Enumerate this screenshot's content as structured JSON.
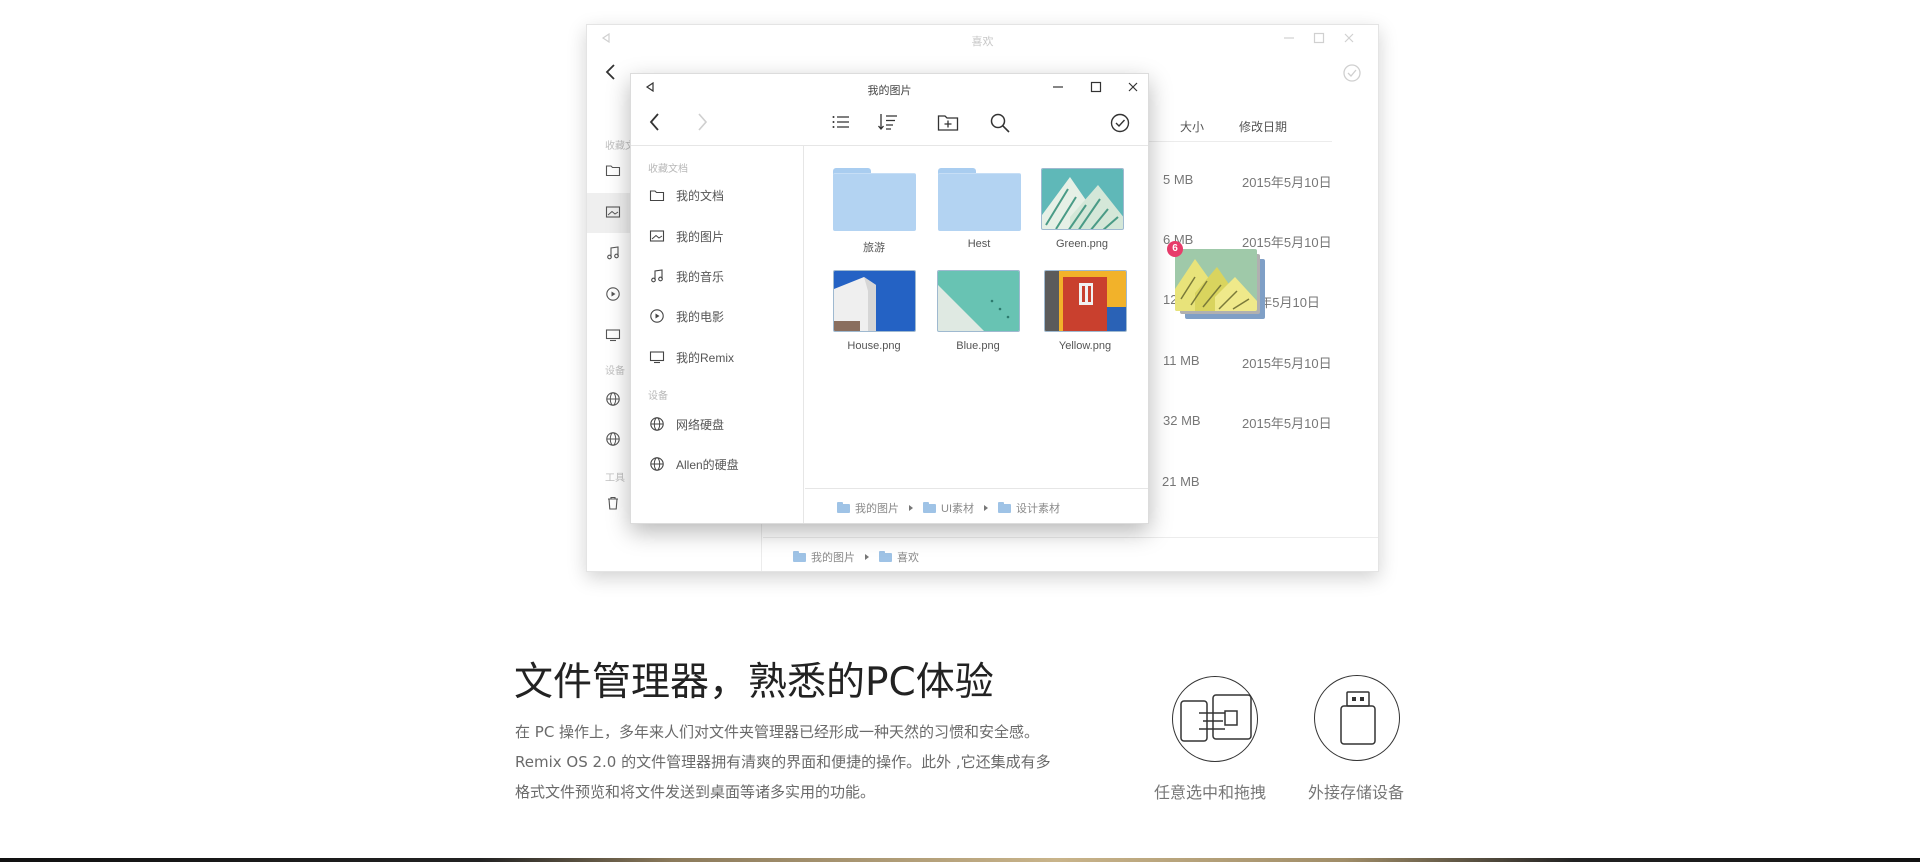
{
  "background_window": {
    "title": "喜欢",
    "columns": {
      "size": "大小",
      "date": "修改日期"
    },
    "sidebar_captions": [
      "收藏文",
      "设备",
      "工具"
    ],
    "rows": [
      {
        "size": "5 MB",
        "date": "2015年5月10日"
      },
      {
        "size": "6 MB",
        "date": "2015年5月10日"
      },
      {
        "size": "12",
        "date": "5年5月10日"
      },
      {
        "size": "11 MB",
        "date": "2015年5月10日"
      },
      {
        "size": "32 MB",
        "date": "2015年5月10日"
      },
      {
        "size": "21 MB",
        "date": ""
      }
    ],
    "breadcrumb": [
      "我的图片",
      "喜欢"
    ]
  },
  "drag": {
    "count": "6"
  },
  "front_window": {
    "title": "我的图片",
    "sidebar": {
      "favorites_caption": "收藏文档",
      "favorites": [
        {
          "label": "我的文档",
          "icon": "folder-icon"
        },
        {
          "label": "我的图片",
          "icon": "image-icon"
        },
        {
          "label": "我的音乐",
          "icon": "music-icon"
        },
        {
          "label": "我的电影",
          "icon": "play-icon"
        },
        {
          "label": "我的Remix",
          "icon": "monitor-icon"
        }
      ],
      "devices_caption": "设备",
      "devices": [
        {
          "label": "网络硬盘",
          "icon": "globe-icon"
        },
        {
          "label": "Allen的硬盘",
          "icon": "globe-icon"
        }
      ]
    },
    "files": [
      {
        "name": "旅游",
        "kind": "folder"
      },
      {
        "name": "Hest",
        "kind": "folder"
      },
      {
        "name": "Green.png",
        "kind": "image"
      },
      {
        "name": "House.png",
        "kind": "image"
      },
      {
        "name": "Blue.png",
        "kind": "image"
      },
      {
        "name": "Yellow.png",
        "kind": "image"
      }
    ],
    "breadcrumb": [
      "我的图片",
      "UI素材",
      "设计素材"
    ]
  },
  "feature": {
    "title": "文件管理器，熟悉的PC体验",
    "desc_line1": "在 PC 操作上，多年来人们对文件夹管理器已经形成一种天然的习惯和安全感。",
    "desc_line2": "Remix OS 2.0 的文件管理器拥有清爽的界面和便捷的操作。此外 ,它还集成有多",
    "desc_line3": "格式文件预览和将文件发送到桌面等诸多实用的功能。",
    "icons": [
      {
        "label": "任意选中和拖拽",
        "icon": "drag-select-icon"
      },
      {
        "label": "外接存储设备",
        "icon": "usb-drive-icon"
      }
    ]
  },
  "colors": {
    "folder_blue": "#b3d3f2",
    "badge_pink": "#e83c6b",
    "green_thumb": "#6ec0b6",
    "house_blue": "#2a64c8",
    "blue_thumb": "#67c2b3",
    "yellow_thumb": "#f0b22b"
  }
}
